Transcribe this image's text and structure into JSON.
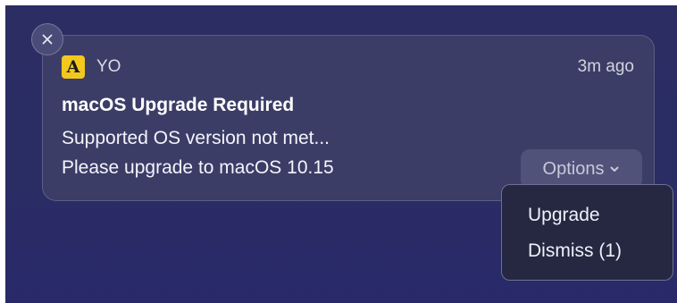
{
  "notification": {
    "app_name": "YO",
    "app_icon_letter": "A",
    "app_icon_color": "#f2c81e",
    "timestamp": "3m ago",
    "title": "macOS Upgrade Required",
    "subtitle": "Supported OS version not met...",
    "body": "Please upgrade to macOS 10.15",
    "close_icon": "close-icon"
  },
  "options": {
    "label": "Options",
    "icon": "chevron-down-icon",
    "menu_items": [
      {
        "label": "Upgrade"
      },
      {
        "label": "Dismiss (1)"
      }
    ]
  }
}
